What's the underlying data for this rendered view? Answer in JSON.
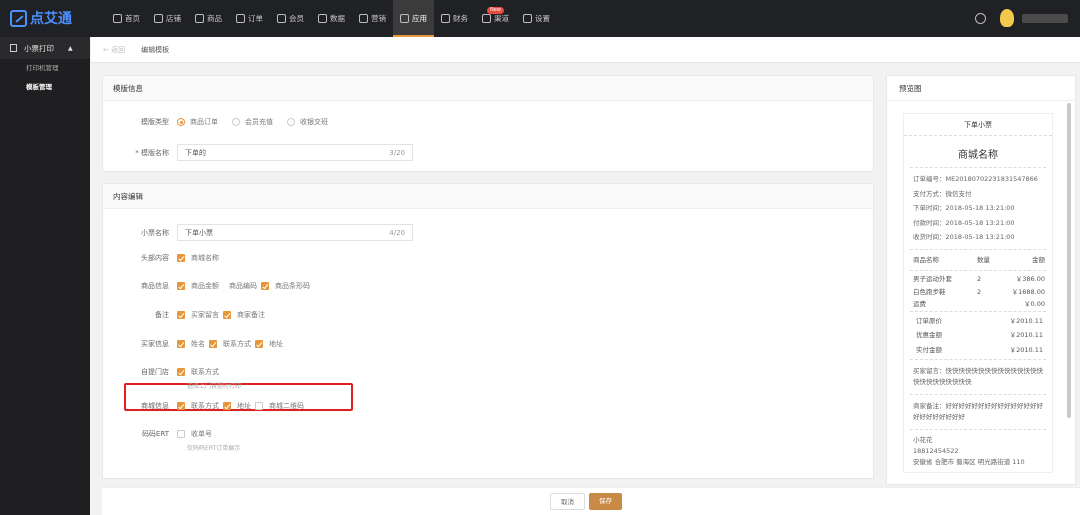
{
  "app": {
    "logo_text": "点艾通"
  },
  "nav": [
    {
      "label": "首页",
      "icon": "home-icon"
    },
    {
      "label": "店铺",
      "icon": "store-icon"
    },
    {
      "label": "商品",
      "icon": "goods-icon"
    },
    {
      "label": "订单",
      "icon": "order-icon"
    },
    {
      "label": "会员",
      "icon": "member-icon"
    },
    {
      "label": "数据",
      "icon": "data-icon"
    },
    {
      "label": "营销",
      "icon": "tag-icon"
    },
    {
      "label": "应用",
      "icon": "app-icon",
      "active": true
    },
    {
      "label": "财务",
      "icon": "finance-icon"
    },
    {
      "label": "渠道",
      "icon": "channel-icon",
      "badge": "New"
    },
    {
      "label": "设置",
      "icon": "gear-icon"
    }
  ],
  "sidebar": {
    "head": "小票打印",
    "items": [
      {
        "label": "打印机管理"
      },
      {
        "label": "模板管理",
        "active": true
      }
    ]
  },
  "breadcrumb": {
    "back": "← 返回",
    "current": "编辑模板"
  },
  "template_info": {
    "title": "模版信息",
    "type_label": "模版类型",
    "type_options": [
      "商品订单",
      "会员充值",
      "收银交班"
    ],
    "type_selected": "商品订单",
    "name_label": "* 模版名称",
    "name_value": "下单的",
    "name_count": "3/20"
  },
  "content_edit": {
    "title": "内容编辑",
    "ticket_name_label": "小票名称",
    "ticket_name_value": "下单小票",
    "ticket_name_count": "4/20",
    "header_label": "头部内容",
    "header_items": [
      "商城名称"
    ],
    "goods_label": "商品信息",
    "goods_items": [
      {
        "label": "商品金额",
        "checked": true
      },
      {
        "label": "商品编码",
        "checked": false
      },
      {
        "label": "商品条形码",
        "checked": true
      }
    ],
    "remark_label": "备注",
    "remark_items": [
      "买家留言",
      "商家备注"
    ],
    "buyer_label": "买家信息",
    "buyer_items": [
      "姓名",
      "联系方式",
      "地址"
    ],
    "store_label": "自提门店",
    "store_items": [
      "联系方式"
    ],
    "store_hint": "选择上门自提时打印",
    "shop_label": "商城信息",
    "shop_items": [
      {
        "label": "联系方式",
        "checked": true
      },
      {
        "label": "地址",
        "checked": true
      },
      {
        "label": "商城二维码",
        "checked": false
      }
    ],
    "ert_label": "码码ERT",
    "ert_item": "收单号",
    "ert_hint": "仅码码ERT订单展示"
  },
  "preview": {
    "title": "预览图",
    "ticket_title": "下单小票",
    "shop_name": "商城名称",
    "lines": [
      "订单编号：ME20180702231831547866",
      "支付方式：微信支付",
      "下单时间：2018-05-18 13:21:00",
      "付款时间：2018-05-18 13:21:00",
      "收货时间：2018-05-18 13:21:00"
    ],
    "table_header": [
      "商品名称",
      "数量",
      "金额"
    ],
    "table_rows": [
      [
        "男子运动外套",
        "2",
        "￥386.00"
      ],
      [
        "白色跑步鞋",
        "2",
        "￥1688.00"
      ],
      [
        "运费",
        "",
        "￥0.00"
      ]
    ],
    "summary": [
      [
        "订单原价",
        "￥2010.11"
      ],
      [
        "优惠金额",
        "￥2010.11"
      ],
      [
        "实付金额",
        "￥2010.11"
      ]
    ],
    "buyer_msg": "买家留言：快快快快快快快快快快快快快快快快快快快快快快快快",
    "seller_msg": "商家备注：好好好好好好好好好好好好好好好好好好好好好好好",
    "contact": [
      "小花花",
      "18812454522",
      "安徽省 合肥市 蜀海区 明光路街道 110"
    ]
  },
  "footer": {
    "cancel": "取消",
    "save": "保存"
  }
}
